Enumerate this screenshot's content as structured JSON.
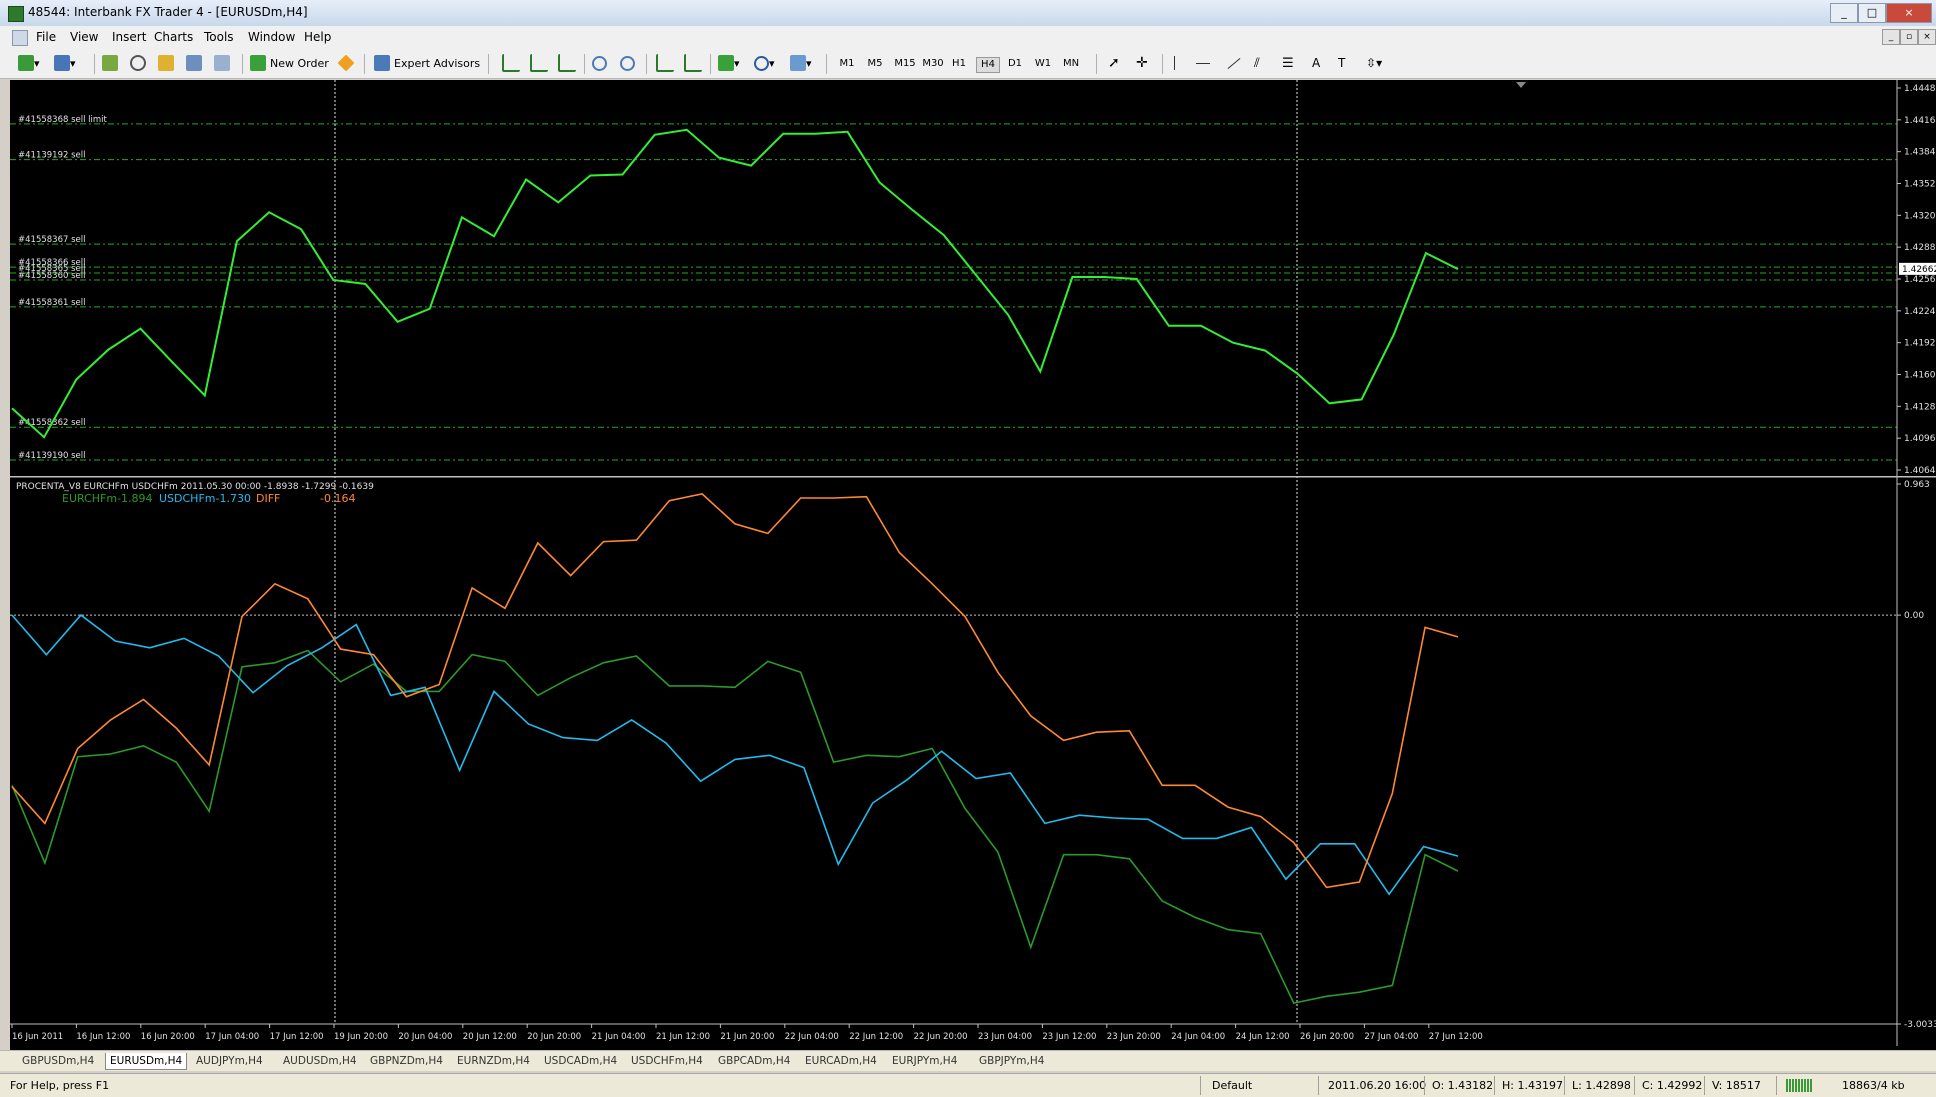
{
  "window": {
    "title": "48544: Interbank FX Trader 4 - [EURUSDm,H4]",
    "buttons": [
      "_",
      "□",
      "×"
    ]
  },
  "menu": [
    "File",
    "View",
    "Insert",
    "Charts",
    "Tools",
    "Window",
    "Help"
  ],
  "toolbar": {
    "new_order": "New Order",
    "expert_advisors": "Expert Advisors",
    "timeframes": [
      "M1",
      "M5",
      "M15",
      "M30",
      "H1",
      "H4",
      "D1",
      "W1",
      "MN"
    ],
    "active_timeframe": "H4",
    "text_tool": "A"
  },
  "chart_data": [
    {
      "type": "line",
      "title": "",
      "x": [
        "16 Jun 2011",
        "16 Jun 12:00",
        "16 Jun 20:00",
        "17 Jun 04:00",
        "17 Jun 12:00",
        "19 Jun 20:00",
        "20 Jun 04:00",
        "20 Jun 12:00",
        "20 Jun 20:00",
        "21 Jun 04:00",
        "21 Jun 12:00",
        "21 Jun 20:00",
        "22 Jun 04:00",
        "22 Jun 12:00",
        "22 Jun 20:00",
        "23 Jun 04:00",
        "23 Jun 12:00",
        "23 Jun 20:00",
        "24 Jun 04:00",
        "24 Jun 12:00",
        "26 Jun 20:00",
        "27 Jun 04:00",
        "27 Jun 12:00"
      ],
      "y_ticks": [
        "1.44480",
        "1.44160",
        "1.43840",
        "1.43520",
        "1.43200",
        "1.42880",
        "1.42560",
        "1.42240",
        "1.41920",
        "1.41600",
        "1.41280",
        "1.40960",
        "1.40640"
      ],
      "ylim": [
        1.4064,
        1.4448
      ],
      "current_price": "1.42662",
      "series": [
        {
          "color": "#33ee33",
          "values": [
            1.4126,
            1.4097,
            1.4155,
            1.4185,
            1.4206,
            1.4172,
            1.4139,
            1.4294,
            1.4323,
            1.4306,
            1.4255,
            1.4251,
            1.4213,
            1.4226,
            1.4318,
            1.4299,
            1.4356,
            1.4333,
            1.436,
            1.4361,
            1.4401,
            1.4406,
            1.4378,
            1.437,
            1.4402,
            1.4402,
            1.4404,
            1.4353,
            1.4326,
            1.43,
            1.426,
            1.422,
            1.4163,
            1.4258,
            1.4258,
            1.4256,
            1.4209,
            1.4209,
            1.4192,
            1.4184,
            1.4161,
            1.4131,
            1.4135,
            1.42,
            1.4282,
            1.4266
          ]
        }
      ],
      "order_lines": [
        {
          "label": "#41558368 sell limit",
          "price": 1.4412
        },
        {
          "label": "#41139192 sell",
          "price": 1.4376
        },
        {
          "label": "#41558367 sell",
          "price": 1.4291
        },
        {
          "label": "#41558366 sell",
          "price": 1.4268
        },
        {
          "label": "#41558365 sell",
          "price": 1.4262
        },
        {
          "label": "#41558360 sell",
          "price": 1.4255
        },
        {
          "label": "#41558361 sell",
          "price": 1.4228
        },
        {
          "label": "#41558362 sell",
          "price": 1.4107
        },
        {
          "label": "#41139190 sell",
          "price": 1.4074
        }
      ]
    },
    {
      "type": "line",
      "title": "PROCENTA_V8 EURCHFm USDCHFm 2011.05.30 00:00  -1.8938 -1.7299 -0.1639",
      "y_ticks": [
        "0.963",
        "0.00",
        "-3.0033"
      ],
      "ylim": [
        -3.0033,
        0.963
      ],
      "zero_line": 0.0,
      "series": [
        {
          "name": "EURCHFm",
          "legend_value": "-1.894",
          "color": "#2a9a2a",
          "values": [
            -1.25,
            -1.82,
            -1.04,
            -1.02,
            -0.96,
            -1.08,
            -1.44,
            -0.38,
            -0.35,
            -0.26,
            -0.49,
            -0.36,
            -0.56,
            -0.56,
            -0.29,
            -0.34,
            -0.59,
            -0.46,
            -0.35,
            -0.3,
            -0.52,
            -0.52,
            -0.53,
            -0.34,
            -0.42,
            -1.08,
            -1.03,
            -1.04,
            -0.98,
            -1.42,
            -1.74,
            -2.44,
            -1.76,
            -1.76,
            -1.79,
            -2.1,
            -2.22,
            -2.31,
            -2.34,
            -2.85,
            -2.8,
            -2.77,
            -2.72,
            -1.76,
            -1.88
          ]
        },
        {
          "name": "USDCHFm",
          "legend_value": "-1.730",
          "color": "#22bbee",
          "values": [
            0.0,
            -0.29,
            0.0,
            -0.19,
            -0.24,
            -0.17,
            -0.3,
            -0.57,
            -0.37,
            -0.24,
            -0.07,
            -0.59,
            -0.53,
            -1.14,
            -0.56,
            -0.8,
            -0.9,
            -0.92,
            -0.77,
            -0.94,
            -1.22,
            -1.06,
            -1.03,
            -1.12,
            -1.83,
            -1.38,
            -1.21,
            -1.0,
            -1.2,
            -1.16,
            -1.53,
            -1.47,
            -1.49,
            -1.5,
            -1.64,
            -1.64,
            -1.56,
            -1.94,
            -1.68,
            -1.68,
            -2.05,
            -1.7,
            -1.77
          ]
        },
        {
          "name": "DIFF",
          "legend_value": "-0.164",
          "color": "#ff8833",
          "values": [
            -1.26,
            -1.53,
            -0.98,
            -0.77,
            -0.62,
            -0.83,
            -1.1,
            -0.01,
            0.23,
            0.12,
            -0.25,
            -0.29,
            -0.6,
            -0.51,
            0.2,
            0.05,
            0.53,
            0.29,
            0.54,
            0.55,
            0.84,
            0.89,
            0.67,
            0.6,
            0.86,
            0.86,
            0.87,
            0.46,
            0.23,
            -0.01,
            -0.42,
            -0.74,
            -0.92,
            -0.86,
            -0.85,
            -1.25,
            -1.25,
            -1.41,
            -1.48,
            -1.67,
            -2.0,
            -1.96,
            -1.31,
            -0.09,
            -0.16
          ]
        }
      ]
    }
  ],
  "tabs": [
    "GBPUSDm,H4",
    "EURUSDm,H4",
    "AUDJPYm,H4",
    "AUDUSDm,H4",
    "GBPNZDm,H4",
    "EURNZDm,H4",
    "USDCADm,H4",
    "USDCHFm,H4",
    "GBPCADm,H4",
    "EURCADm,H4",
    "EURJPYm,H4",
    "GBPJPYm,H4"
  ],
  "active_tab": "EURUSDm,H4",
  "status": {
    "help": "For Help, press F1",
    "profile": "Default",
    "datetime": "2011.06.20 16:00",
    "open": "O: 1.43182",
    "high": "H: 1.43197",
    "low": "L: 1.42898",
    "close": "C: 1.42992",
    "volume": "V: 18517",
    "traffic": "18863/4 kb"
  }
}
